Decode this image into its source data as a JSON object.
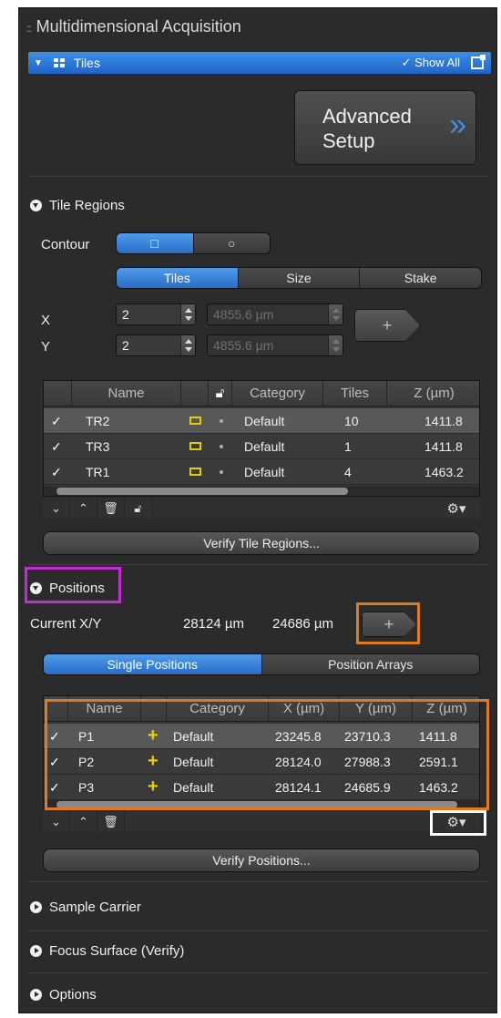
{
  "panel": {
    "title": "Multidimensional Acquisition",
    "grip": "::"
  },
  "tiles_bar": {
    "label": "Tiles",
    "show_all": "✓ Show All"
  },
  "advanced": {
    "line1": "Advanced",
    "line2": "Setup",
    "chevron": "»"
  },
  "tile_regions": {
    "title": "Tile Regions",
    "contour_label": "Contour",
    "contour_options": [
      "□",
      "○"
    ],
    "tabs": [
      "Tiles",
      "Size",
      "Stake"
    ],
    "x_label": "X",
    "y_label": "Y",
    "x_count": "2",
    "y_count": "2",
    "x_size": "4855.6 µm",
    "y_size": "4855.6 µm",
    "add_symbol": "+",
    "columns": [
      "Name",
      "Category",
      "Tiles",
      "Z (µm)"
    ],
    "rows": [
      {
        "name": "TR2",
        "category": "Default",
        "tiles": "10",
        "z": "1411.8"
      },
      {
        "name": "TR3",
        "category": "Default",
        "tiles": "1",
        "z": "1411.8"
      },
      {
        "name": "TR1",
        "category": "Default",
        "tiles": "4",
        "z": "1463.2"
      }
    ],
    "verify_label": "Verify Tile Regions..."
  },
  "positions": {
    "title": "Positions",
    "current_label": "Current X/Y",
    "current_x": "28124 µm",
    "current_y": "24686 µm",
    "add_symbol": "+",
    "tabs": [
      "Single Positions",
      "Position Arrays"
    ],
    "columns": [
      "Name",
      "Category",
      "X (µm)",
      "Y (µm)",
      "Z (µm)"
    ],
    "rows": [
      {
        "name": "P1",
        "category": "Default",
        "x": "23245.8",
        "y": "23710.3",
        "z": "1411.8"
      },
      {
        "name": "P2",
        "category": "Default",
        "x": "28124.0",
        "y": "27988.3",
        "z": "2591.1"
      },
      {
        "name": "P3",
        "category": "Default",
        "x": "28124.1",
        "y": "24685.9",
        "z": "1463.2"
      }
    ],
    "verify_label": "Verify Positions..."
  },
  "collapsed_sections": [
    "Sample Carrier",
    "Focus Surface (Verify)",
    "Options"
  ],
  "colors": {
    "accent": "#2a6cc6",
    "highlight_purple": "#c42ad6",
    "highlight_orange": "#e07a1f",
    "icon_yellow": "#e0d000"
  }
}
